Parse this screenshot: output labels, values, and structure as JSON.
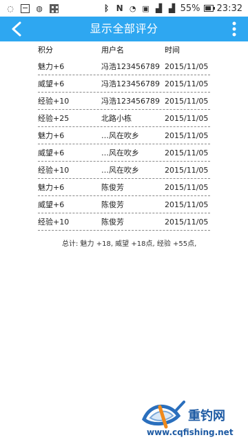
{
  "status_bar": {
    "battery": "55%",
    "time": "23:32"
  },
  "header": {
    "title": "显示全部评分"
  },
  "table": {
    "headers": [
      "积分",
      "用户名",
      "时间"
    ],
    "rows": [
      {
        "score": "魅力+6",
        "user": "冯浩123456789",
        "time": "2015/11/05"
      },
      {
        "score": "威望+6",
        "user": "冯浩123456789",
        "time": "2015/11/05"
      },
      {
        "score": "经验+10",
        "user": "冯浩123456789",
        "time": "2015/11/05"
      },
      {
        "score": "经验+25",
        "user": "北路小栋",
        "time": "2015/11/05"
      },
      {
        "score": "魅力+6",
        "user": "…风在吹乡",
        "time": "2015/11/05"
      },
      {
        "score": "威望+6",
        "user": "…风在吹乡",
        "time": "2015/11/05"
      },
      {
        "score": "经验+10",
        "user": "…风在吹乡",
        "time": "2015/11/05"
      },
      {
        "score": "魅力+6",
        "user": "陈俊芳",
        "time": "2015/11/05"
      },
      {
        "score": "威望+6",
        "user": "陈俊芳",
        "time": "2015/11/05"
      },
      {
        "score": "经验+10",
        "user": "陈俊芳",
        "time": "2015/11/05"
      }
    ]
  },
  "summary": {
    "text": "总计: 魅力 +18, 威望 +18点, 经验 +55点,"
  },
  "watermark": {
    "brand": "重钓网",
    "url": "www.cqfishing.net"
  },
  "colors": {
    "app_bar": "#2ea7f1",
    "watermark": "#1d5aa3"
  }
}
